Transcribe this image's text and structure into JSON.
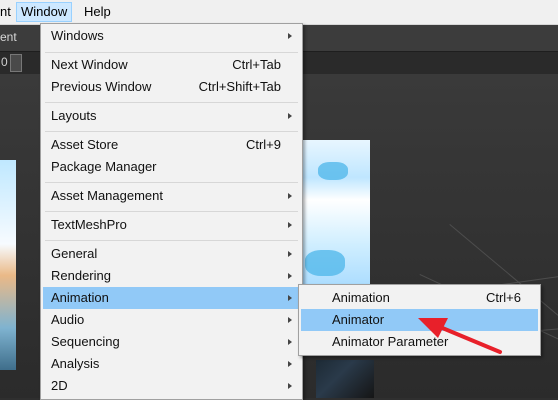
{
  "menubar": {
    "partial_item": "nt",
    "window": "Window",
    "help": "Help"
  },
  "editor": {
    "tab_fragment": "ent",
    "toolbar_fragment": "0"
  },
  "window_menu": {
    "items": [
      {
        "label": "Windows",
        "shortcut": "",
        "submenu": true
      },
      {
        "label": "Next Window",
        "shortcut": "Ctrl+Tab",
        "submenu": false
      },
      {
        "label": "Previous Window",
        "shortcut": "Ctrl+Shift+Tab",
        "submenu": false
      },
      {
        "label": "Layouts",
        "shortcut": "",
        "submenu": true
      },
      {
        "label": "Asset Store",
        "shortcut": "Ctrl+9",
        "submenu": false
      },
      {
        "label": "Package Manager",
        "shortcut": "",
        "submenu": false
      },
      {
        "label": "Asset Management",
        "shortcut": "",
        "submenu": true
      },
      {
        "label": "TextMeshPro",
        "shortcut": "",
        "submenu": true
      },
      {
        "label": "General",
        "shortcut": "",
        "submenu": true
      },
      {
        "label": "Rendering",
        "shortcut": "",
        "submenu": true
      },
      {
        "label": "Animation",
        "shortcut": "",
        "submenu": true,
        "highlighted": true
      },
      {
        "label": "Audio",
        "shortcut": "",
        "submenu": true
      },
      {
        "label": "Sequencing",
        "shortcut": "",
        "submenu": true
      },
      {
        "label": "Analysis",
        "shortcut": "",
        "submenu": true
      },
      {
        "label": "2D",
        "shortcut": "",
        "submenu": true
      }
    ]
  },
  "animation_submenu": {
    "items": [
      {
        "label": "Animation",
        "shortcut": "Ctrl+6"
      },
      {
        "label": "Animator",
        "shortcut": "",
        "highlighted": true
      },
      {
        "label": "Animator Parameter",
        "shortcut": ""
      }
    ]
  },
  "colors": {
    "highlight": "#91c9f7",
    "menu_bg": "#f2f2f2",
    "annotation_arrow": "#e8202a"
  }
}
